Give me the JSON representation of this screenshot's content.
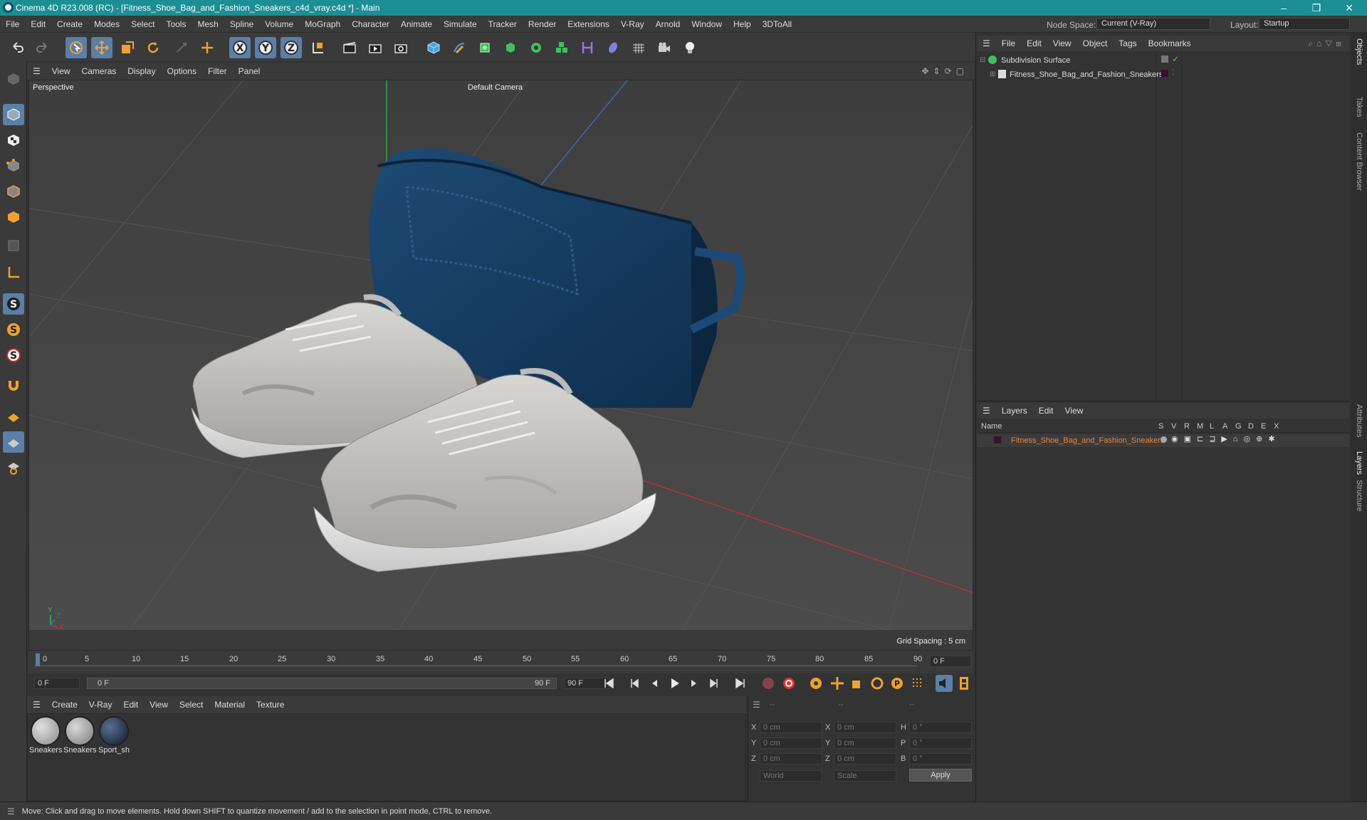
{
  "window": {
    "title": "Cinema 4D R23.008 (RC) - [Fitness_Shoe_Bag_and_Fashion_Sneakers_c4d_vray.c4d *] - Main",
    "minimize": "–",
    "maximize": "❐",
    "close": "✕"
  },
  "menu": [
    "File",
    "Edit",
    "Create",
    "Modes",
    "Select",
    "Tools",
    "Mesh",
    "Spline",
    "Volume",
    "MoGraph",
    "Character",
    "Animate",
    "Simulate",
    "Tracker",
    "Render",
    "Extensions",
    "V-Ray",
    "Arnold",
    "Window",
    "Help",
    "3DToAll"
  ],
  "node_space": {
    "label": "Node Space:",
    "value": "Current (V-Ray)"
  },
  "layout": {
    "label": "Layout:",
    "value": "Startup"
  },
  "viewport": {
    "menu": [
      "View",
      "Cameras",
      "Display",
      "Options",
      "Filter",
      "Panel"
    ],
    "name": "Perspective",
    "camera": "Default Camera",
    "grid_spacing": "Grid Spacing : 5 cm",
    "axis_y": "Y",
    "axis_z": "Z",
    "axis_x": "X"
  },
  "timeline": {
    "ticks": [
      "0",
      "5",
      "10",
      "15",
      "20",
      "25",
      "30",
      "35",
      "40",
      "45",
      "50",
      "55",
      "60",
      "65",
      "70",
      "75",
      "80",
      "85",
      "90"
    ],
    "current_frame": "0 F"
  },
  "transport": {
    "start": "0 F",
    "range_start": "0 F",
    "range_end": "90 F",
    "end": "90 F"
  },
  "material_menu": [
    "Create",
    "V-Ray",
    "Edit",
    "View",
    "Select",
    "Material",
    "Texture"
  ],
  "materials": [
    {
      "name": "Sneakers",
      "color": "#b9b9b9"
    },
    {
      "name": "Sneakers",
      "color": "#a9a9a9"
    },
    {
      "name": "Sport_sh",
      "color": "#1c2c44"
    }
  ],
  "coords": {
    "headers": [
      "--",
      "--",
      "--"
    ],
    "rows": [
      {
        "a": "X",
        "av": "0 cm",
        "b": "X",
        "bv": "0 cm",
        "c": "H",
        "cv": "0 °"
      },
      {
        "a": "Y",
        "av": "0 cm",
        "b": "Y",
        "bv": "0 cm",
        "c": "P",
        "cv": "0 °"
      },
      {
        "a": "Z",
        "av": "0 cm",
        "b": "Z",
        "bv": "0 cm",
        "c": "B",
        "cv": "0 °"
      }
    ],
    "space": "World",
    "mode": "Scale",
    "apply": "Apply"
  },
  "object_manager": {
    "menu": [
      "File",
      "Edit",
      "View",
      "Object",
      "Tags",
      "Bookmarks"
    ],
    "objects": [
      "Subdivision Surface",
      "Fitness_Shoe_Bag_and_Fashion_Sneakers"
    ]
  },
  "layers": {
    "menu": [
      "Layers",
      "Edit",
      "View"
    ],
    "name_col": "Name",
    "cols": [
      "S",
      "V",
      "R",
      "M",
      "L",
      "A",
      "G",
      "D",
      "E",
      "X"
    ],
    "rows": [
      "Fitness_Shoe_Bag_and_Fashion_Sneakers"
    ]
  },
  "side_tabs": [
    "Objects",
    "Takes",
    "Content Browser",
    "Attributes",
    "Layers",
    "Structure"
  ],
  "status": "Move: Click and drag to move elements. Hold down SHIFT to quantize movement / add to the selection in point mode, CTRL to remove.",
  "colors": {
    "accent": "#1b8f94",
    "selected": "#5a7fa8",
    "layer_text": "#e8843a",
    "bag": "#173a5c"
  }
}
